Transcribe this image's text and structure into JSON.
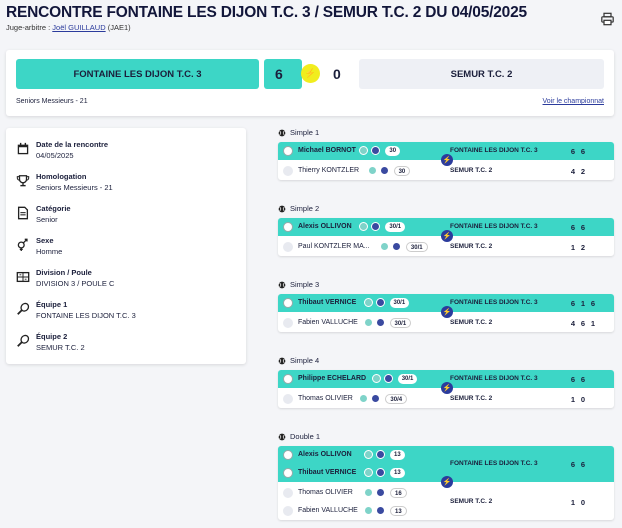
{
  "header": {
    "title": "RENCONTRE FONTAINE LES DIJON T.C. 3 / SEMUR T.C. 2 DU 04/05/2025",
    "referee_label": "Juge-arbitre :",
    "referee_name": "Joël GUILLAUD",
    "referee_code": "(JAE1)",
    "print_icon": "printer-icon"
  },
  "score": {
    "home_team": "FONTAINE LES DIJON T.C. 3",
    "home_score": "6",
    "away_score": "0",
    "away_team": "SEMUR T.C. 2",
    "category": "Seniors Messieurs - 21",
    "championship_link": "Voir le championnat",
    "accent": "#3dd6c6",
    "bolt_color": "#f1ed1e"
  },
  "info": [
    {
      "icon": "calendar-icon",
      "label": "Date de la rencontre",
      "value": "04/05/2025"
    },
    {
      "icon": "trophy-icon",
      "label": "Homologation",
      "value": "Seniors Messieurs - 21"
    },
    {
      "icon": "document-icon",
      "label": "Catégorie",
      "value": "Senior"
    },
    {
      "icon": "gender-icon",
      "label": "Sexe",
      "value": "Homme"
    },
    {
      "icon": "division-icon",
      "label": "Division / Poule",
      "value": "DIVISION 3 / POULE C"
    },
    {
      "icon": "racket-icon",
      "label": "Équipe 1",
      "value": "FONTAINE LES DIJON T.C. 3"
    },
    {
      "icon": "racket-icon",
      "label": "Équipe 2",
      "value": "SEMUR T.C. 2"
    }
  ],
  "matches": [
    {
      "label": "Simple 1",
      "rows": [
        {
          "name": "Michael BORNOT",
          "rank": "30",
          "club": "FONTAINE LES DIJON T.C. 3",
          "sets": [
            "6",
            "6"
          ]
        },
        {
          "name": "Thierry KONTZLER",
          "rank": "30",
          "club": "SEMUR T.C. 2",
          "sets": [
            "4",
            "2"
          ]
        }
      ]
    },
    {
      "label": "Simple 2",
      "rows": [
        {
          "name": "Alexis OLLIVON",
          "rank": "30/1",
          "club": "FONTAINE LES DIJON T.C. 3",
          "sets": [
            "6",
            "6"
          ]
        },
        {
          "name": "Paul KONTZLER MA...",
          "rank": "30/1",
          "club": "SEMUR T.C. 2",
          "sets": [
            "1",
            "2"
          ]
        }
      ]
    },
    {
      "label": "Simple 3",
      "rows": [
        {
          "name": "Thibaut VERNICE",
          "rank": "30/1",
          "club": "FONTAINE LES DIJON T.C. 3",
          "sets": [
            "6",
            "1",
            "6"
          ]
        },
        {
          "name": "Fabien VALLUCHE",
          "rank": "30/1",
          "club": "SEMUR T.C. 2",
          "sets": [
            "4",
            "6",
            "1"
          ]
        }
      ]
    },
    {
      "label": "Simple 4",
      "rows": [
        {
          "name": "Philippe ECHELARD",
          "rank": "30/1",
          "club": "FONTAINE LES DIJON T.C. 3",
          "sets": [
            "6",
            "6"
          ]
        },
        {
          "name": "Thomas OLIVIER",
          "rank": "30/4",
          "club": "SEMUR T.C. 2",
          "sets": [
            "1",
            "0"
          ]
        }
      ]
    },
    {
      "label": "Double 1",
      "double": true,
      "rows": [
        {
          "name": "Alexis OLLIVON",
          "rank": "13"
        },
        {
          "name": "Thibaut VERNICE",
          "rank": "13",
          "club": "FONTAINE LES DIJON T.C. 3",
          "sets": [
            "6",
            "6"
          ]
        },
        {
          "name": "Thomas OLIVIER",
          "rank": "16"
        },
        {
          "name": "Fabien VALLUCHE",
          "rank": "13",
          "club": "SEMUR T.C. 2",
          "sets": [
            "1",
            "0"
          ]
        }
      ]
    }
  ]
}
